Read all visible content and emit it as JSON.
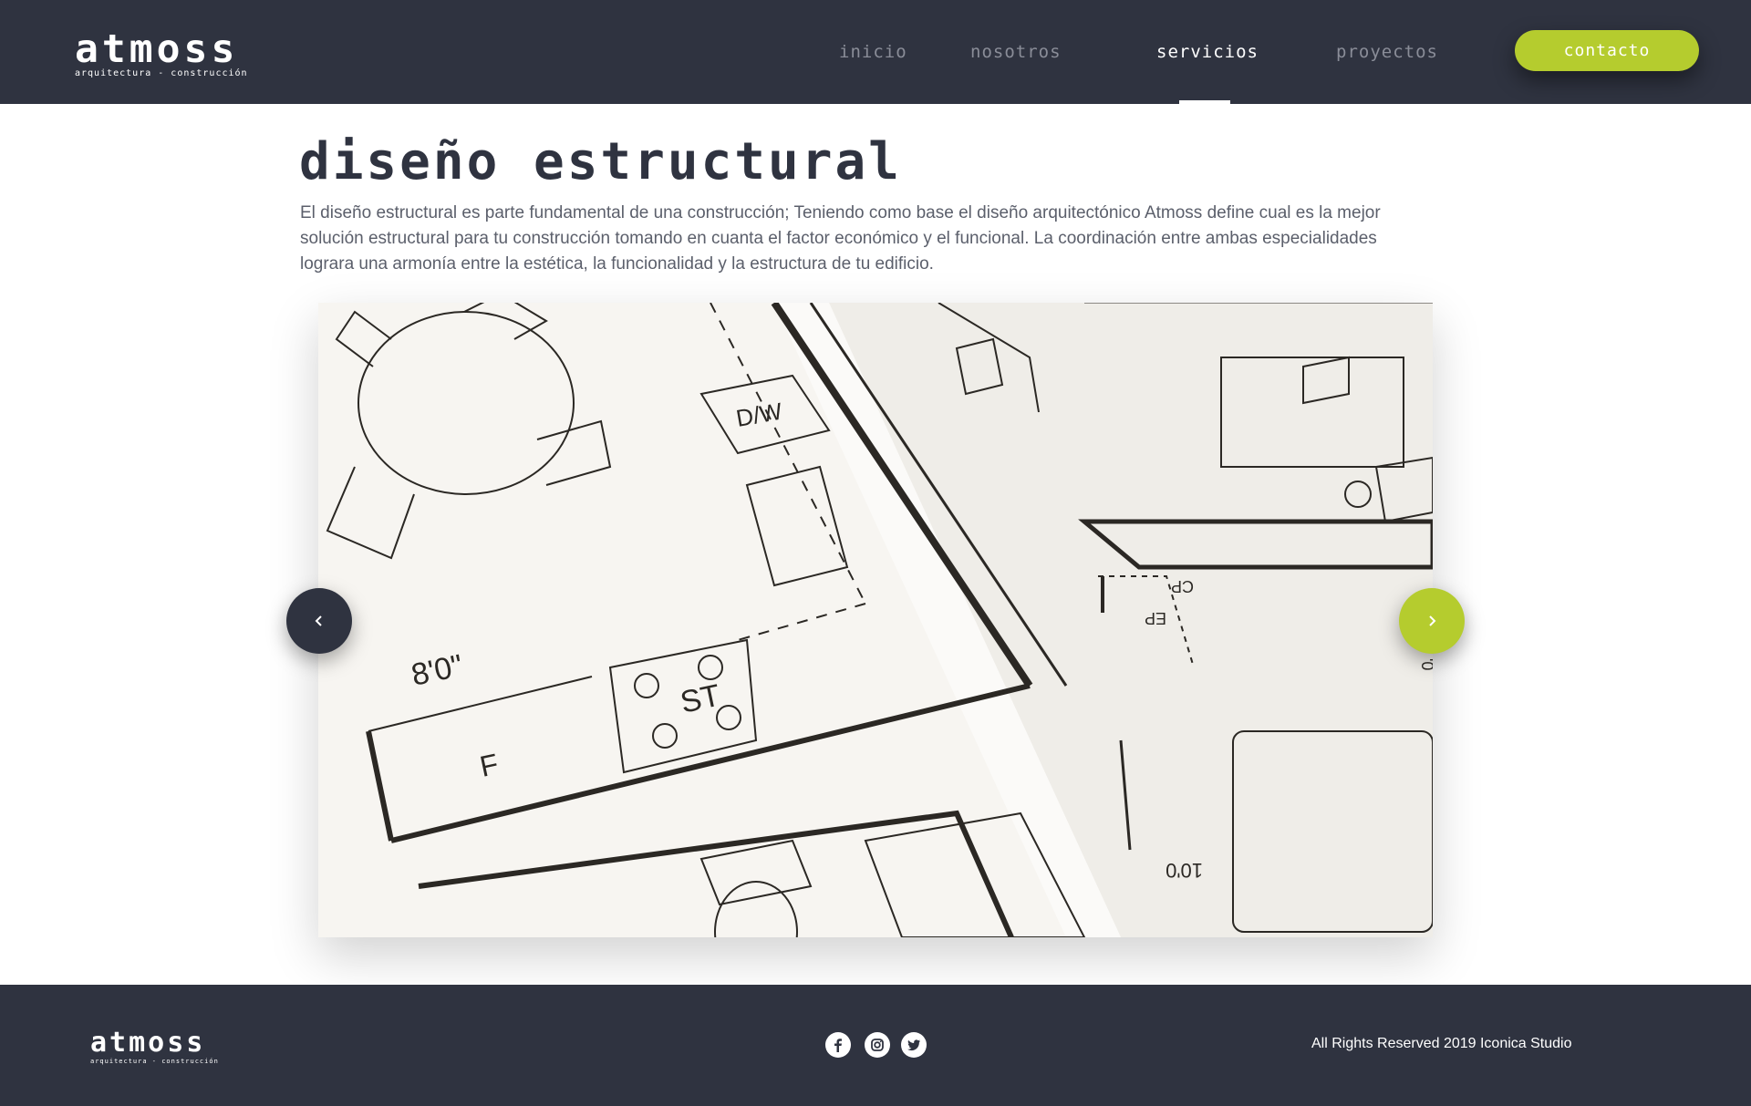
{
  "brand": {
    "name": "atmoss",
    "tagline": "arquitectura - construcción"
  },
  "nav": {
    "items": [
      {
        "label": "inicio"
      },
      {
        "label": "nosotros"
      },
      {
        "label": "servicios",
        "active": true
      },
      {
        "label": "proyectos"
      }
    ],
    "contact_label": "contacto"
  },
  "main": {
    "title": "diseño estructural",
    "description": "El diseño estructural es parte fundamental de una construcción; Teniendo como base el diseño arquitectónico Atmoss define cual es la mejor solución estructural para tu construcción tomando en cuanta el factor económico y el funcional. La coordinación entre ambas especialidades lograra una armonía entre la estética, la funcionalidad y la estructura de tu edificio.",
    "slider": {
      "image_icon": "blueprint-image",
      "prev_icon": "chevron-left-icon",
      "next_icon": "chevron-right-icon"
    }
  },
  "footer": {
    "social": [
      "facebook-icon",
      "instagram-icon",
      "twitter-icon"
    ],
    "copyright": "All Rights Reserved 2019 Iconica Studio"
  },
  "colors": {
    "dark": "#2f3340",
    "accent": "#b5cc2e",
    "text": "#5b5f6b"
  }
}
